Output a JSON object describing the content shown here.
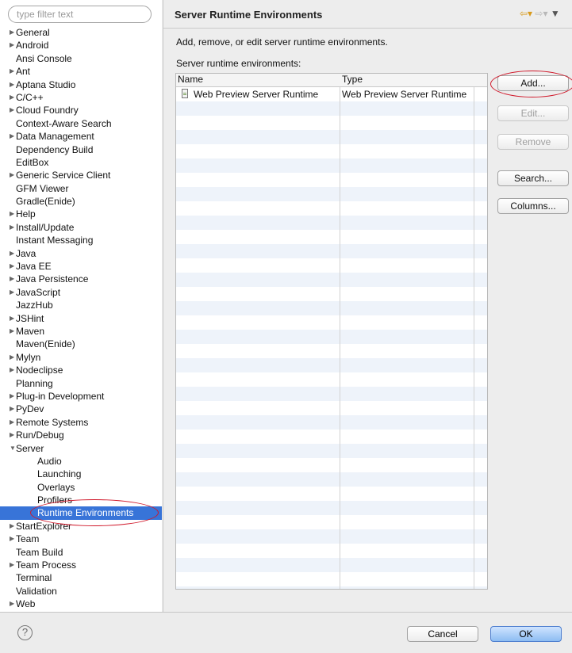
{
  "filter": {
    "placeholder": "type filter text"
  },
  "tree": [
    {
      "label": "General",
      "arrow": "right",
      "level": 0
    },
    {
      "label": "Android",
      "arrow": "right",
      "level": 0
    },
    {
      "label": "Ansi Console",
      "arrow": "",
      "level": 0
    },
    {
      "label": "Ant",
      "arrow": "right",
      "level": 0
    },
    {
      "label": "Aptana Studio",
      "arrow": "right",
      "level": 0
    },
    {
      "label": "C/C++",
      "arrow": "right",
      "level": 0
    },
    {
      "label": "Cloud Foundry",
      "arrow": "right",
      "level": 0
    },
    {
      "label": "Context-Aware Search",
      "arrow": "",
      "level": 0
    },
    {
      "label": "Data Management",
      "arrow": "right",
      "level": 0
    },
    {
      "label": "Dependency Build",
      "arrow": "",
      "level": 0
    },
    {
      "label": "EditBox",
      "arrow": "",
      "level": 0
    },
    {
      "label": "Generic Service Client",
      "arrow": "right",
      "level": 0
    },
    {
      "label": "GFM Viewer",
      "arrow": "",
      "level": 0
    },
    {
      "label": "Gradle(Enide)",
      "arrow": "",
      "level": 0
    },
    {
      "label": "Help",
      "arrow": "right",
      "level": 0
    },
    {
      "label": "Install/Update",
      "arrow": "right",
      "level": 0
    },
    {
      "label": "Instant Messaging",
      "arrow": "",
      "level": 0
    },
    {
      "label": "Java",
      "arrow": "right",
      "level": 0
    },
    {
      "label": "Java EE",
      "arrow": "right",
      "level": 0
    },
    {
      "label": "Java Persistence",
      "arrow": "right",
      "level": 0
    },
    {
      "label": "JavaScript",
      "arrow": "right",
      "level": 0
    },
    {
      "label": "JazzHub",
      "arrow": "",
      "level": 0
    },
    {
      "label": "JSHint",
      "arrow": "right",
      "level": 0
    },
    {
      "label": "Maven",
      "arrow": "right",
      "level": 0
    },
    {
      "label": "Maven(Enide)",
      "arrow": "",
      "level": 0
    },
    {
      "label": "Mylyn",
      "arrow": "right",
      "level": 0
    },
    {
      "label": "Nodeclipse",
      "arrow": "right",
      "level": 0
    },
    {
      "label": "Planning",
      "arrow": "",
      "level": 0
    },
    {
      "label": "Plug-in Development",
      "arrow": "right",
      "level": 0
    },
    {
      "label": "PyDev",
      "arrow": "right",
      "level": 0
    },
    {
      "label": "Remote Systems",
      "arrow": "right",
      "level": 0
    },
    {
      "label": "Run/Debug",
      "arrow": "right",
      "level": 0
    },
    {
      "label": "Server",
      "arrow": "down",
      "level": 0
    },
    {
      "label": "Audio",
      "arrow": "",
      "level": 1
    },
    {
      "label": "Launching",
      "arrow": "",
      "level": 1
    },
    {
      "label": "Overlays",
      "arrow": "",
      "level": 1
    },
    {
      "label": "Profilers",
      "arrow": "",
      "level": 1
    },
    {
      "label": "Runtime Environments",
      "arrow": "",
      "level": 1,
      "selected": true
    },
    {
      "label": "StartExplorer",
      "arrow": "right",
      "level": 0
    },
    {
      "label": "Team",
      "arrow": "right",
      "level": 0
    },
    {
      "label": "Team Build",
      "arrow": "",
      "level": 0
    },
    {
      "label": "Team Process",
      "arrow": "right",
      "level": 0
    },
    {
      "label": "Terminal",
      "arrow": "",
      "level": 0
    },
    {
      "label": "Validation",
      "arrow": "",
      "level": 0
    },
    {
      "label": "Web",
      "arrow": "right",
      "level": 0
    }
  ],
  "page": {
    "title": "Server Runtime Environments",
    "description": "Add, remove, or edit server runtime environments.",
    "table_label": "Server runtime environments:"
  },
  "nav": {
    "back_icon": "back-arrow-icon",
    "forward_icon": "forward-arrow-icon",
    "menu_icon": "menu-chevron-icon"
  },
  "table": {
    "columns": [
      "Name",
      "Type"
    ],
    "rows": [
      {
        "name": "Web Preview Server Runtime",
        "type": "Web Preview Server Runtime",
        "icon": "runtime-doc-icon"
      }
    ]
  },
  "buttons": {
    "add": "Add...",
    "edit": "Edit...",
    "remove": "Remove",
    "search": "Search...",
    "columns": "Columns..."
  },
  "footer": {
    "help": "?",
    "cancel": "Cancel",
    "ok": "OK"
  },
  "colors": {
    "selection": "#3874d8",
    "highlight_ellipse": "#d0182a"
  }
}
